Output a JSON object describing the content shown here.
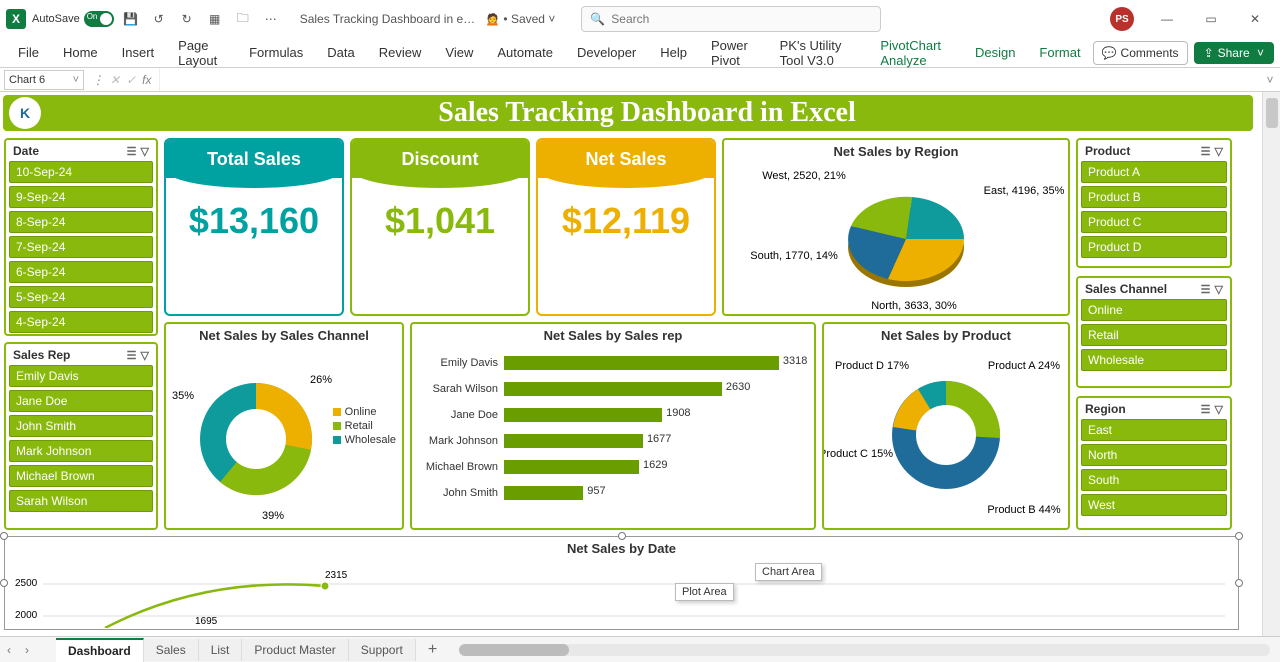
{
  "window": {
    "autosave_label": "AutoSave",
    "autosave_state": "On",
    "doc_title": "Sales Tracking Dashboard in e…",
    "saved_status": "Saved",
    "search_placeholder": "Search",
    "user_initials": "PS"
  },
  "ribbon": {
    "tabs": [
      "File",
      "Home",
      "Insert",
      "Page Layout",
      "Formulas",
      "Data",
      "Review",
      "View",
      "Automate",
      "Developer",
      "Help",
      "Power Pivot",
      "PK's Utility Tool V3.0",
      "PivotChart Analyze",
      "Design",
      "Format"
    ],
    "contextual_start": 13,
    "comments_label": "Comments",
    "share_label": "Share"
  },
  "formula_bar": {
    "name_box": "Chart 6",
    "fx": "fx"
  },
  "banner": {
    "title": "Sales Tracking Dashboard in Excel",
    "logo_text": "K"
  },
  "slicers": {
    "date": {
      "title": "Date",
      "items": [
        "10-Sep-24",
        "9-Sep-24",
        "8-Sep-24",
        "7-Sep-24",
        "6-Sep-24",
        "5-Sep-24",
        "4-Sep-24"
      ]
    },
    "sales_rep": {
      "title": "Sales Rep",
      "items": [
        "Emily Davis",
        "Jane Doe",
        "John Smith",
        "Mark Johnson",
        "Michael Brown",
        "Sarah Wilson"
      ]
    },
    "product": {
      "title": "Product",
      "items": [
        "Product A",
        "Product B",
        "Product C",
        "Product D"
      ]
    },
    "sales_channel": {
      "title": "Sales Channel",
      "items": [
        "Online",
        "Retail",
        "Wholesale"
      ]
    },
    "region": {
      "title": "Region",
      "items": [
        "East",
        "North",
        "South",
        "West"
      ]
    }
  },
  "kpi": {
    "total_sales": {
      "label": "Total Sales",
      "value": "$13,160"
    },
    "discount": {
      "label": "Discount",
      "value": "$1,041"
    },
    "net_sales": {
      "label": "Net Sales",
      "value": "$12,119"
    }
  },
  "chart_data": [
    {
      "id": "net_sales_region",
      "type": "pie",
      "title": "Net Sales by Region",
      "series": [
        {
          "name": "East",
          "value": 4196,
          "pct": 35,
          "label": "East, 4196, 35%"
        },
        {
          "name": "North",
          "value": 3633,
          "pct": 30,
          "label": "North, 3633, 30%"
        },
        {
          "name": "West",
          "value": 2520,
          "pct": 21,
          "label": "West, 2520, 21%"
        },
        {
          "name": "South",
          "value": 1770,
          "pct": 14,
          "label": "South, 1770, 14%"
        }
      ]
    },
    {
      "id": "net_sales_channel",
      "type": "donut",
      "title": "Net Sales by Sales Channel",
      "series": [
        {
          "name": "Online",
          "pct": 26
        },
        {
          "name": "Retail",
          "pct": 39
        },
        {
          "name": "Wholesale",
          "pct": 35
        }
      ],
      "legend": [
        "Online",
        "Retail",
        "Wholesale"
      ]
    },
    {
      "id": "net_sales_rep",
      "type": "bar",
      "title": "Net Sales by Sales rep",
      "categories": [
        "Emily Davis",
        "Sarah Wilson",
        "Jane Doe",
        "Mark Johnson",
        "Michael Brown",
        "John Smith"
      ],
      "values": [
        3318,
        2630,
        1908,
        1677,
        1629,
        957
      ],
      "xlim": [
        0,
        3500
      ]
    },
    {
      "id": "net_sales_product",
      "type": "donut",
      "title": "Net Sales by Product",
      "series": [
        {
          "name": "Product A",
          "pct": 24,
          "label": "Product A 24%"
        },
        {
          "name": "Product B",
          "pct": 44,
          "label": "Product B 44%"
        },
        {
          "name": "Product C",
          "pct": 15,
          "label": "Product C 15%"
        },
        {
          "name": "Product D",
          "pct": 17,
          "label": "Product D 17%"
        }
      ]
    },
    {
      "id": "net_sales_date",
      "type": "line",
      "title": "Net Sales  by Date",
      "y_ticks": [
        2000,
        2500
      ],
      "values": [
        1695,
        2315
      ],
      "tooltip_plot": "Plot Area",
      "tooltip_chart": "Chart Area"
    }
  ],
  "sheet_tabs": [
    "Dashboard",
    "Sales",
    "List",
    "Product Master",
    "Support"
  ],
  "colors": {
    "olive": "#8ab90d",
    "olive_dark": "#6a9e00",
    "teal": "#00a1a1",
    "teal_dark": "#0f7b8a",
    "orange": "#eeb000",
    "blue": "#1f6b9a"
  }
}
